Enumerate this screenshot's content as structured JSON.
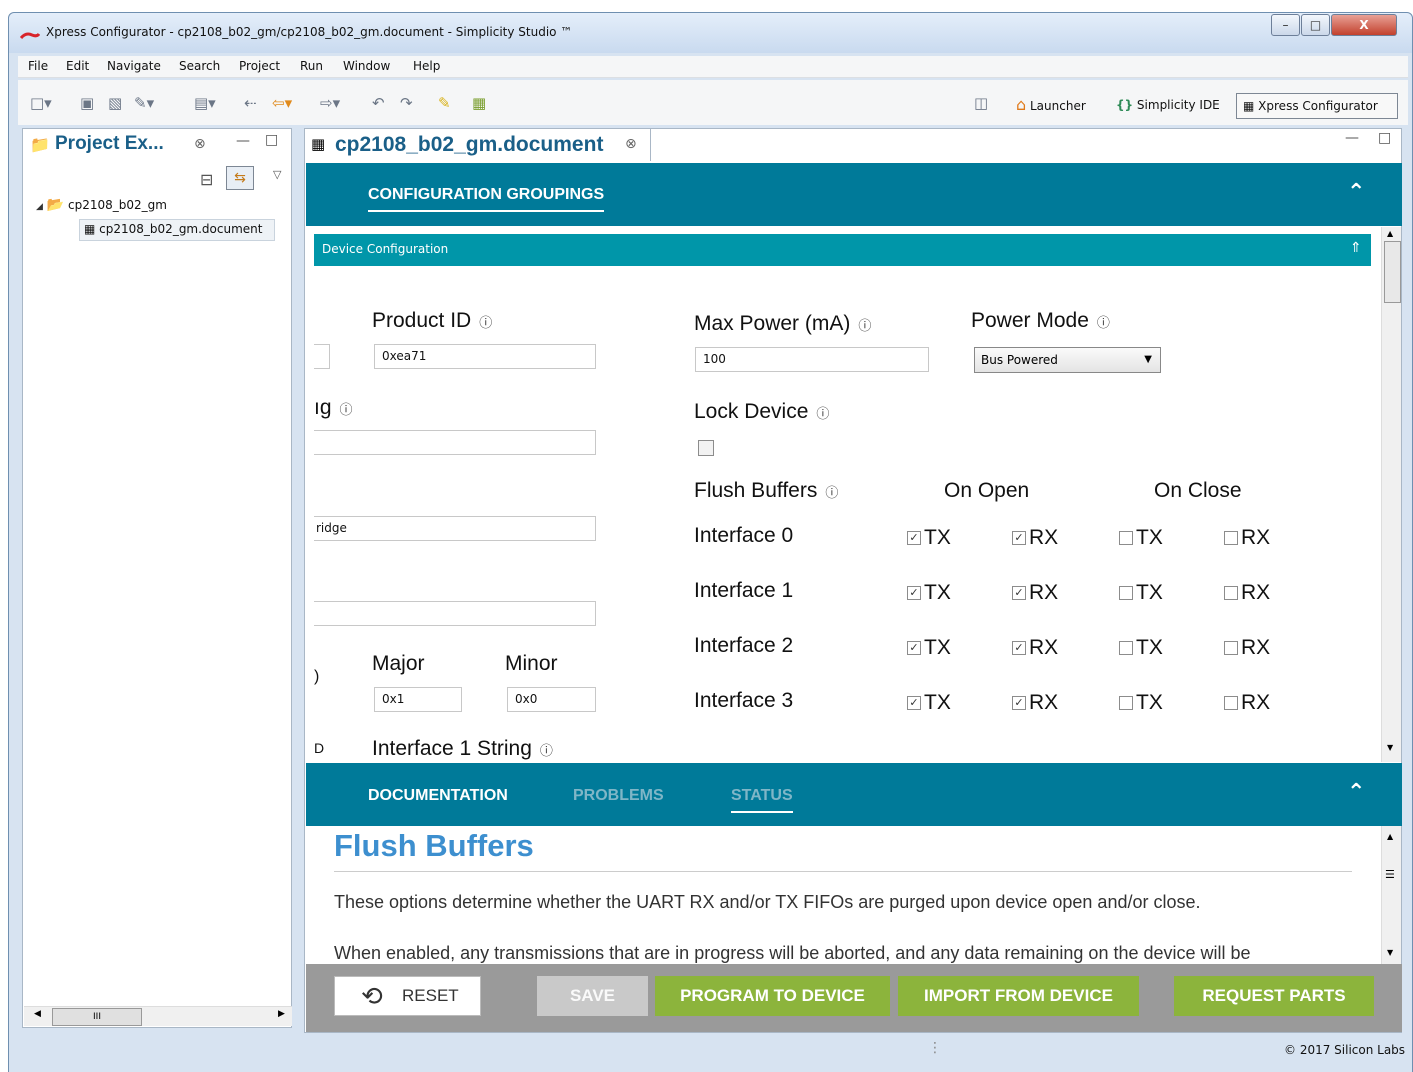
{
  "window": {
    "title": "Xpress Configurator - cp2108_b02_gm/cp2108_b02_gm.document - Simplicity Studio ™",
    "minimize": "–",
    "maximize": "□",
    "close": "X"
  },
  "menu": [
    "File",
    "Edit",
    "Navigate",
    "Search",
    "Project",
    "Run",
    "Window",
    "Help"
  ],
  "perspectives": {
    "launcher": "Launcher",
    "ide": "Simplicity IDE",
    "xpress": "Xpress Configurator"
  },
  "project_explorer": {
    "tab_label": "Project Ex...",
    "project": "cp2108_b02_gm",
    "document": "cp2108_b02_gm.document",
    "hscroll_thumb": "III"
  },
  "editor": {
    "tab_label": "cp2108_b02_gm.document",
    "header_tab": "CONFIGURATION GROUPINGS",
    "section": "Device Configuration",
    "fields": {
      "product_id_label": "Product ID",
      "product_id_value": "0xea71",
      "max_power_label": "Max Power (mA)",
      "max_power_value": "100",
      "power_mode_label": "Power Mode",
      "power_mode_value": "Bus Powered",
      "lock_device_label": "Lock Device",
      "partial_label_1": "ıg",
      "partial_value_3": "ridge",
      "major_label": "Major",
      "major_value": "0x1",
      "minor_label": "Minor",
      "minor_value": "0x0",
      "interface1_string_label": "Interface 1 String",
      "partial_clip_1": ")",
      "partial_clip_2": "D"
    },
    "flush": {
      "title": "Flush Buffers",
      "on_open": "On Open",
      "on_close": "On Close",
      "tx": "TX",
      "rx": "RX",
      "rows": [
        {
          "label": "Interface 0",
          "open_tx": true,
          "open_rx": true,
          "close_tx": false,
          "close_rx": false
        },
        {
          "label": "Interface 1",
          "open_tx": true,
          "open_rx": true,
          "close_tx": false,
          "close_rx": false
        },
        {
          "label": "Interface 2",
          "open_tx": true,
          "open_rx": true,
          "close_tx": false,
          "close_rx": false
        },
        {
          "label": "Interface 3",
          "open_tx": true,
          "open_rx": true,
          "close_tx": false,
          "close_rx": false
        }
      ]
    }
  },
  "bottom": {
    "tabs": {
      "documentation": "DOCUMENTATION",
      "problems": "PROBLEMS",
      "status": "STATUS"
    },
    "doc_title": "Flush Buffers",
    "doc_p1": "These options determine whether the UART RX and/or TX FIFOs are purged upon device open and/or close.",
    "doc_p2": "When enabled, any transmissions that are in progress will be aborted, and any data remaining on the device will be"
  },
  "actions": {
    "reset": "RESET",
    "save": "SAVE",
    "program": "PROGRAM TO DEVICE",
    "import": "IMPORT FROM DEVICE",
    "request": "REQUEST PARTS"
  },
  "status_bar": {
    "copyright": "© 2017 Silicon Labs"
  },
  "colors": {
    "teal": "#007a99",
    "section": "#0096a9",
    "green": "#8cb43c",
    "doc_title": "#3d8fcf"
  }
}
